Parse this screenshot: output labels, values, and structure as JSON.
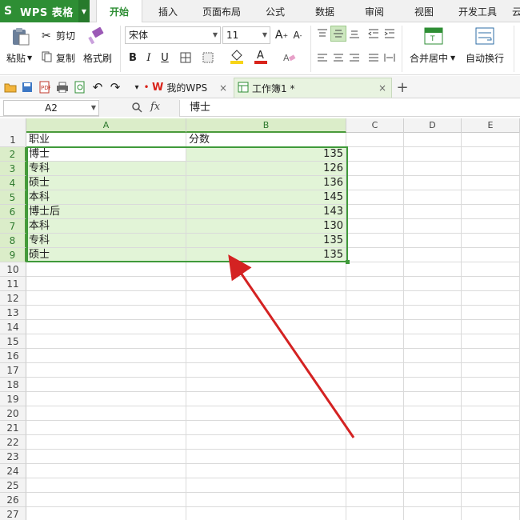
{
  "app": {
    "logo_letter": "S",
    "title": "WPS 表格"
  },
  "menu": {
    "tabs": [
      {
        "label": "开始",
        "active": true
      },
      {
        "label": "插入"
      },
      {
        "label": "页面布局"
      },
      {
        "label": "公式"
      },
      {
        "label": "数据"
      },
      {
        "label": "审阅"
      },
      {
        "label": "视图"
      },
      {
        "label": "开发工具"
      },
      {
        "label": "云"
      }
    ]
  },
  "ribbon": {
    "paste_label": "粘贴",
    "cut_label": "剪切",
    "copy_label": "复制",
    "format_painter_label": "格式刷",
    "font_name": "宋体",
    "font_size": "11",
    "bold": "B",
    "italic": "I",
    "underline": "U",
    "merge_center_label": "合并居中",
    "wrap_text_label": "自动换行",
    "font_color": "#d9241b",
    "fill_color": "#f7d418"
  },
  "doc_tabs": [
    {
      "label": "我的WPS",
      "active": false
    },
    {
      "label": "工作簿1 *",
      "active": true
    }
  ],
  "formula_bar": {
    "name_box": "A2",
    "fx_label": "fx",
    "content": "博士"
  },
  "sheet": {
    "columns": [
      "A",
      "B",
      "C",
      "D",
      "E"
    ],
    "header_row": {
      "A": "职业",
      "B": "分数"
    },
    "data_rows": [
      {
        "A": "博士",
        "B": "135"
      },
      {
        "A": "专科",
        "B": "126"
      },
      {
        "A": "硕士",
        "B": "136"
      },
      {
        "A": "本科",
        "B": "145"
      },
      {
        "A": "博士后",
        "B": "143"
      },
      {
        "A": "本科",
        "B": "130"
      },
      {
        "A": "专科",
        "B": "135"
      },
      {
        "A": "硕士",
        "B": "135"
      }
    ],
    "row_numbers": [
      "1",
      "2",
      "3",
      "4",
      "5",
      "6",
      "7",
      "8",
      "9",
      "10",
      "11",
      "12",
      "13",
      "14",
      "15",
      "16",
      "17",
      "18",
      "19",
      "20",
      "21",
      "22",
      "23",
      "24",
      "25",
      "26",
      "27"
    ],
    "selection": "A2:B9",
    "active_cell": "A2"
  },
  "colors": {
    "accent_green": "#2e8e34",
    "selection_fill": "#e2f4d7",
    "annotation_arrow": "#d42222"
  }
}
